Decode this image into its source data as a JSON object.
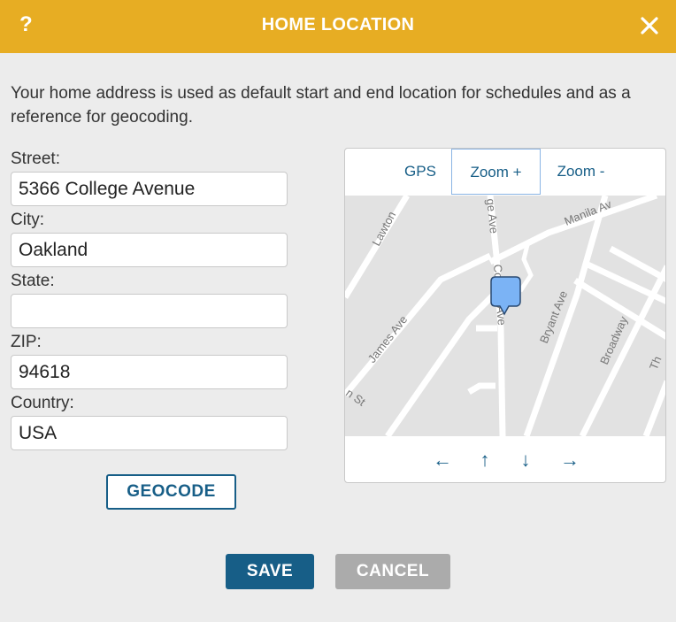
{
  "header": {
    "help_label": "?",
    "title": "HOME LOCATION"
  },
  "description": "Your home address is used as default start and end location for schedules and as a reference for geocoding.",
  "form": {
    "street": {
      "label": "Street:",
      "value": "5366 College Avenue"
    },
    "city": {
      "label": "City:",
      "value": "Oakland"
    },
    "state": {
      "label": "State:",
      "value": ""
    },
    "zip": {
      "label": "ZIP:",
      "value": "94618"
    },
    "country": {
      "label": "Country:",
      "value": "USA"
    },
    "geocode_label": "GEOCODE"
  },
  "map": {
    "tools": {
      "gps": "GPS",
      "zoom_in": "Zoom +",
      "zoom_out": "Zoom -",
      "active": "zoom_in"
    },
    "nav": {
      "left": "←",
      "up": "↑",
      "down": "↓",
      "right": "→"
    },
    "streets": {
      "lawton": "Lawton",
      "college_top": "ge Ave",
      "manila": "Manila Av",
      "college_mid": "College Ave",
      "james": "James Ave",
      "bryant": "Bryant Ave",
      "broadway": "Broadway",
      "st": "n St",
      "edge_t": "Th"
    },
    "marker_icon": "map-pin-icon",
    "marker_color": "#7bb3f5"
  },
  "actions": {
    "save": "SAVE",
    "cancel": "CANCEL"
  },
  "colors": {
    "header": "#e7ad23",
    "primary": "#175e87",
    "disabled": "#ababab"
  }
}
